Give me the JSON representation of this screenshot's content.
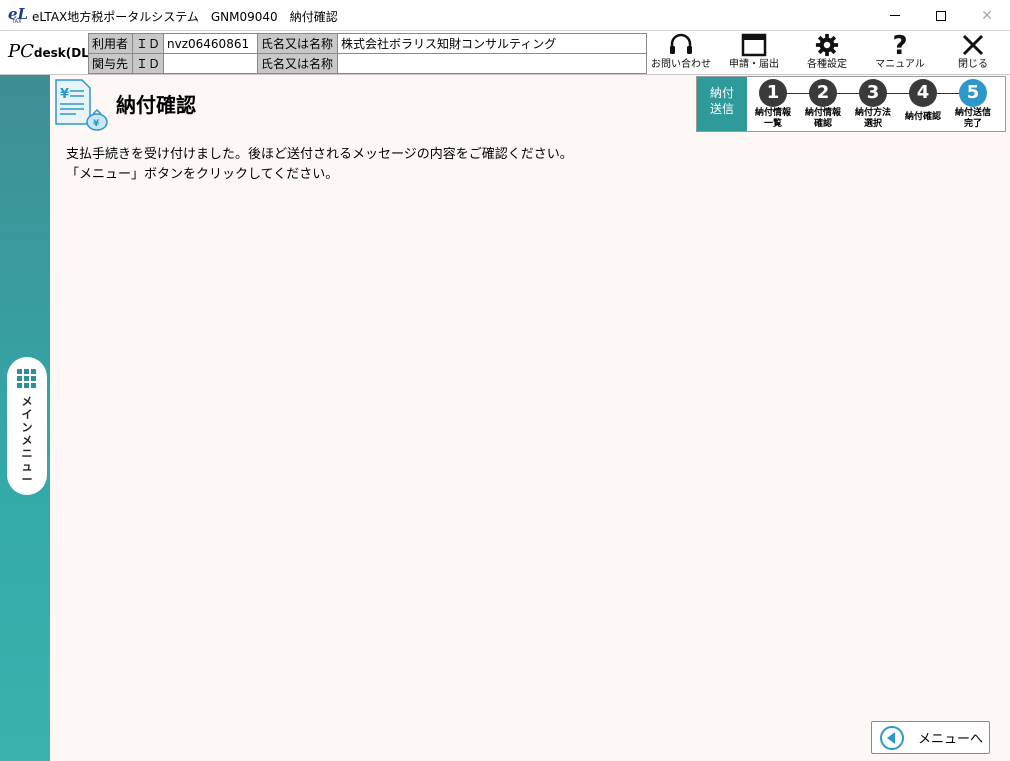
{
  "window": {
    "title": "eLTAX地方税ポータルシステム　GNM09040　納付確認",
    "logo_e": "eL",
    "logo_tax": "TAX"
  },
  "header": {
    "logo_pc": "PC",
    "logo_desk": "desk(DL版)",
    "user": {
      "role_label": "利用者",
      "id_label": "ＩＤ",
      "id_value": "nvz06460861",
      "name_label": "氏名又は名称",
      "name_value": "株式会社ボラリス知財コンサルティング"
    },
    "related": {
      "role_label": "関与先",
      "id_label": "ＩＤ",
      "id_value": "",
      "name_label": "氏名又は名称",
      "name_value": ""
    },
    "tools": [
      {
        "label": "お問い合わせ",
        "icon": "headset-icon"
      },
      {
        "label": "申請・届出",
        "icon": "window-icon"
      },
      {
        "label": "各種設定",
        "icon": "gear-icon"
      },
      {
        "label": "マニュアル",
        "icon": "question-icon"
      },
      {
        "label": "閉じる",
        "icon": "close-icon"
      }
    ]
  },
  "sidebar": {
    "main_menu_label": "メインメニュー"
  },
  "page": {
    "title": "納付確認",
    "message_line1": "支払手続きを受け付けました。後ほど送付されるメッセージの内容をご確認ください。",
    "message_line2": "「メニュー」ボタンをクリックしてください。"
  },
  "steps": {
    "stage_line1": "納付",
    "stage_line2": "送信",
    "items": [
      {
        "number": "1",
        "label_line1": "納付情報",
        "label_line2": "一覧"
      },
      {
        "number": "2",
        "label_line1": "納付情報",
        "label_line2": "確認"
      },
      {
        "number": "3",
        "label_line1": "納付方法",
        "label_line2": "選択"
      },
      {
        "number": "4",
        "label_line1": "納付確認",
        "label_line2": ""
      },
      {
        "number": "5",
        "label_line1": "納付送信",
        "label_line2": "完了"
      }
    ],
    "active_step": 5,
    "colors": {
      "active": "#2e97c9",
      "inactive": "#3a3a3a",
      "stage": "#2f9a9a"
    }
  },
  "footer": {
    "menu_button_label": "メニューへ"
  }
}
